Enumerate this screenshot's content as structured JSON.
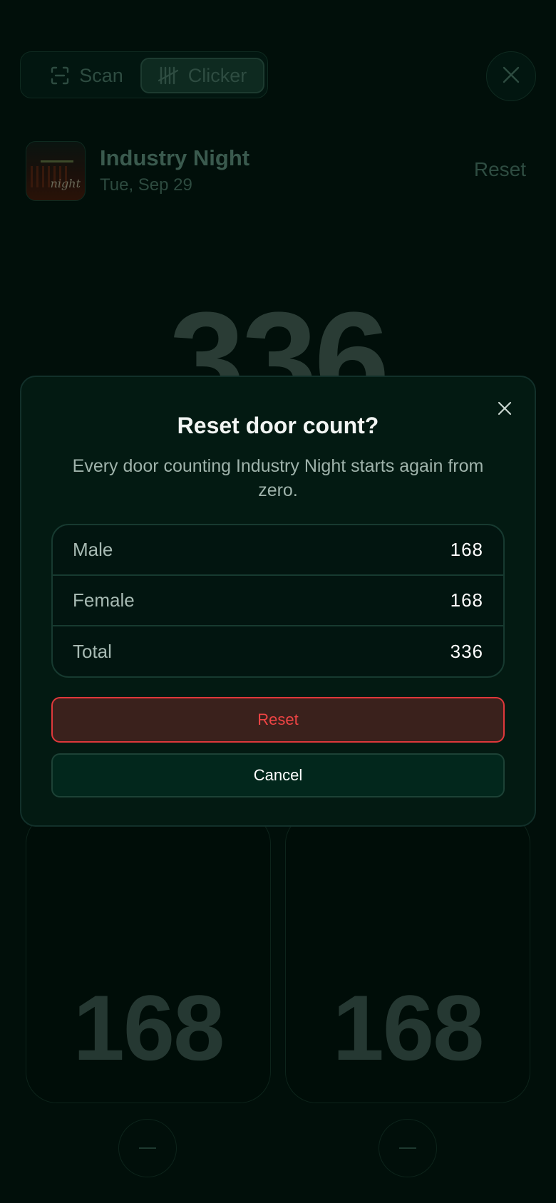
{
  "mode_switch": {
    "scan_label": "Scan",
    "clicker_label": "Clicker",
    "selected": "Clicker"
  },
  "event": {
    "title": "Industry Night",
    "date": "Tue, Sep 29",
    "thumbnail_text": "night",
    "reset_label": "Reset"
  },
  "counter": {
    "total": "336",
    "male": "168",
    "female": "168"
  },
  "dialog": {
    "title": "Reset door count?",
    "description": "Every door counting Industry Night starts again from zero.",
    "rows": [
      {
        "label": "Male",
        "value": "168"
      },
      {
        "label": "Female",
        "value": "168"
      },
      {
        "label": "Total",
        "value": "336"
      }
    ],
    "confirm_label": "Reset",
    "cancel_label": "Cancel"
  },
  "colors": {
    "background": "#010f0a",
    "danger": "#ef4444",
    "dialog_bg": "#031a12"
  }
}
